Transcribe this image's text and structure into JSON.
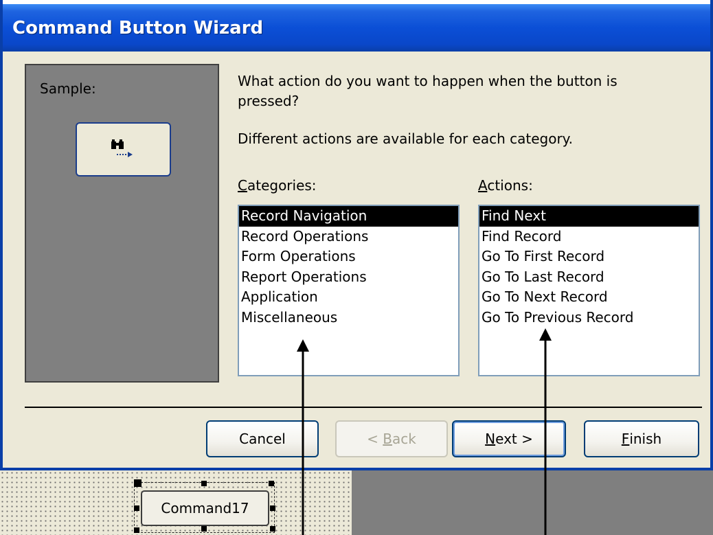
{
  "window": {
    "title": "Command Button Wizard"
  },
  "sample": {
    "label": "Sample:",
    "button_icon": "find-next-binoculars-icon"
  },
  "prompt": {
    "question": "What action do you want to happen when the button is pressed?",
    "hint": "Different actions are available for each category."
  },
  "categories": {
    "label_mnemonic": "C",
    "label_rest": "ategories:",
    "items": [
      "Record Navigation",
      "Record Operations",
      "Form Operations",
      "Report Operations",
      "Application",
      "Miscellaneous"
    ],
    "selected": "Record Navigation"
  },
  "actions": {
    "label_mnemonic": "A",
    "label_rest": "ctions:",
    "items": [
      "Find Next",
      "Find Record",
      "Go To First Record",
      "Go To Last Record",
      "Go To Next Record",
      "Go To Previous Record"
    ],
    "selected": "Find Next"
  },
  "buttons": {
    "cancel": "Cancel",
    "back_prefix": "< ",
    "back_mnemonic": "B",
    "back_rest": "ack",
    "next_mnemonic": "N",
    "next_rest": "ext >",
    "finish_mnemonic": "F",
    "finish_rest": "inish"
  },
  "design": {
    "control_caption": "Command17"
  },
  "colors": {
    "title_bar": "#0a47c9",
    "selection": "#000000",
    "dialog_bg": "#ece9d8",
    "sample_bg": "#808080"
  }
}
